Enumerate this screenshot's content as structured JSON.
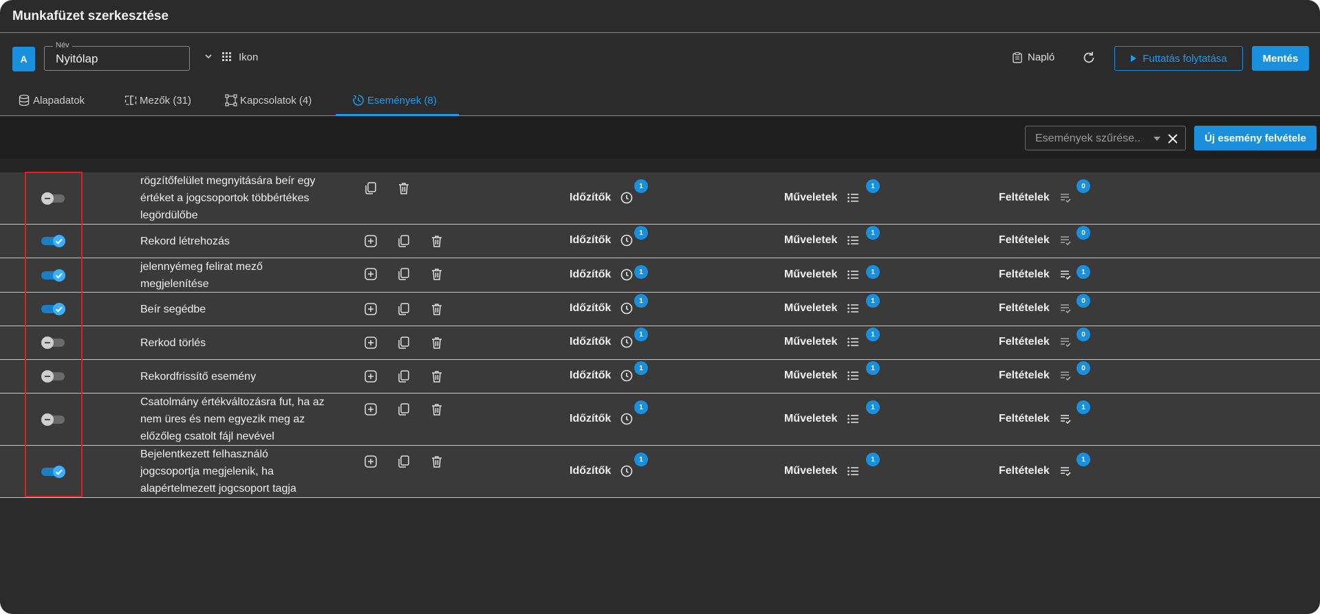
{
  "window": {
    "title": "Munkafüzet szerkesztése"
  },
  "toolbar": {
    "avatar_letter": "A",
    "name_legend": "Név",
    "name_value": "Nyitólap",
    "icon_label": "Ikon",
    "log_label": "Napló",
    "continue_label": "Futtatás folytatása",
    "save_label": "Mentés"
  },
  "tabs": [
    {
      "label": "Alapadatok",
      "icon": "database-icon"
    },
    {
      "label": "Mezők (31)",
      "icon": "field-icon"
    },
    {
      "label": "Kapcsolatok (4)",
      "icon": "connections-icon"
    },
    {
      "label": "Események (8)",
      "icon": "events-icon",
      "active": true
    }
  ],
  "filter": {
    "placeholder": "Események szűrése..",
    "new_event_label": "Új esemény felvétele"
  },
  "column_labels": {
    "timers": "Időzítők",
    "operations": "Műveletek",
    "conditions": "Feltételek"
  },
  "events": [
    {
      "enabled": false,
      "lines": [
        "rögzítőfelület megnyitására beír egy",
        "értéket a jogcsoportok többértékes",
        "legördülőbe"
      ],
      "has_add": false,
      "timers": "1",
      "operations": "1",
      "conditions": "0"
    },
    {
      "enabled": true,
      "lines": [
        "Rekord létrehozás"
      ],
      "has_add": true,
      "timers": "1",
      "operations": "1",
      "conditions": "0"
    },
    {
      "enabled": true,
      "lines": [
        "jelennyémeg felirat mező",
        "megjelenítése"
      ],
      "has_add": true,
      "timers": "1",
      "operations": "1",
      "conditions": "1"
    },
    {
      "enabled": true,
      "lines": [
        "Beír segédbe"
      ],
      "has_add": true,
      "timers": "1",
      "operations": "1",
      "conditions": "0"
    },
    {
      "enabled": false,
      "lines": [
        "Rerkod törlés"
      ],
      "has_add": true,
      "timers": "1",
      "operations": "1",
      "conditions": "0"
    },
    {
      "enabled": false,
      "lines": [
        "Rekordfrissítő esemény"
      ],
      "has_add": true,
      "timers": "1",
      "operations": "1",
      "conditions": "0"
    },
    {
      "enabled": false,
      "lines": [
        "Csatolmány értékváltozásra fut, ha az",
        "nem üres és nem egyezik meg az",
        "előzőleg csatolt fájl nevével"
      ],
      "has_add": true,
      "timers": "1",
      "operations": "1",
      "conditions": "1"
    },
    {
      "enabled": true,
      "lines": [
        "Bejelentkezett felhasználó",
        "jogcsoportja megjelenik, ha",
        "alapértelmezett jogcsoport tagja"
      ],
      "has_add": true,
      "timers": "1",
      "operations": "1",
      "conditions": "1"
    }
  ],
  "colors": {
    "accent": "#1a8fdc",
    "background": "#2b2b2b",
    "row": "#3a3a3a",
    "highlight": "#e02020"
  }
}
